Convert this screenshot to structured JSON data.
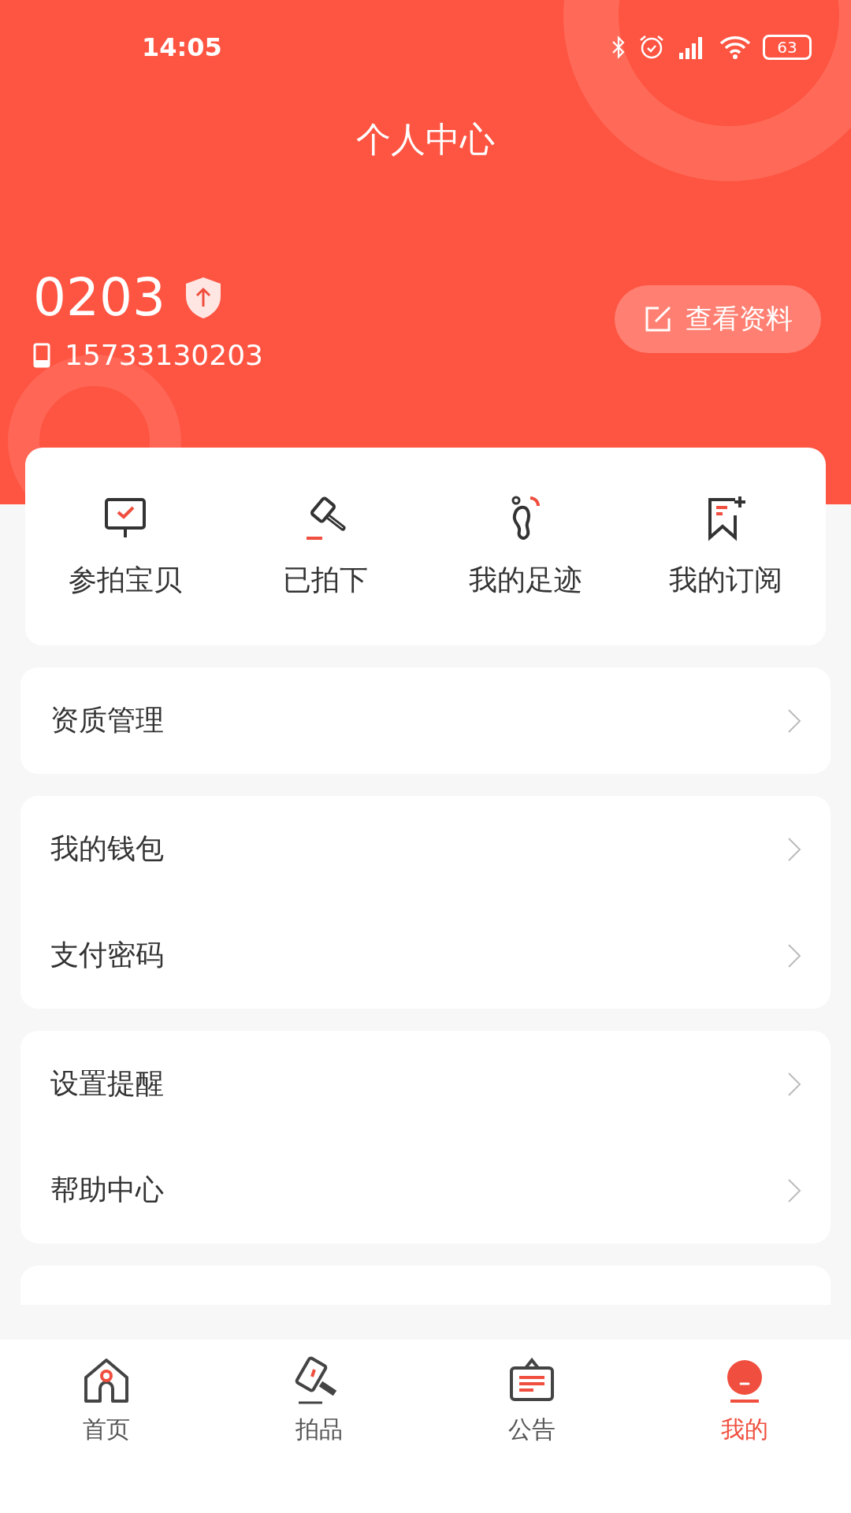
{
  "status_bar": {
    "time": "14:05",
    "battery": "63"
  },
  "header": {
    "title": "个人中心",
    "username": "0203",
    "phone": "15733130203",
    "profile_button": "查看资料"
  },
  "quick_actions": [
    {
      "kind": "auction",
      "label": "参拍宝贝"
    },
    {
      "kind": "won",
      "label": "已拍下"
    },
    {
      "kind": "footprint",
      "label": "我的足迹"
    },
    {
      "kind": "subscribe",
      "label": "我的订阅"
    }
  ],
  "menu_groups": [
    {
      "items": [
        "资质管理"
      ]
    },
    {
      "items": [
        "我的钱包",
        "支付密码"
      ]
    },
    {
      "items": [
        "设置提醒",
        "帮助中心"
      ]
    },
    {
      "kind": "clipped"
    }
  ],
  "bottom_nav": [
    {
      "kind": "home",
      "label": "首页",
      "selected": false
    },
    {
      "kind": "lots",
      "label": "拍品",
      "selected": false
    },
    {
      "kind": "notice",
      "label": "公告",
      "selected": false
    },
    {
      "kind": "me",
      "label": "我的",
      "selected": true
    }
  ]
}
